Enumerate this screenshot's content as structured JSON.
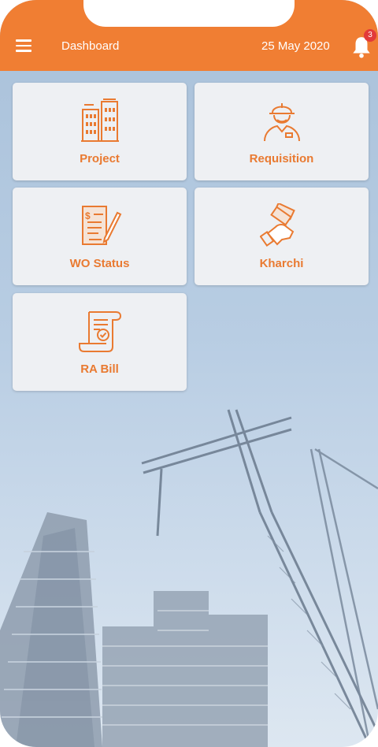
{
  "header": {
    "title": "Dashboard",
    "date": "25 May 2020",
    "notification_count": "3",
    "menu_icon": "hamburger-menu-icon",
    "bell_icon": "bell-icon",
    "color": "#f07e33"
  },
  "tiles": [
    {
      "label": "Project",
      "icon": "buildings-icon"
    },
    {
      "label": "Requisition",
      "icon": "worker-icon"
    },
    {
      "label": "WO Status",
      "icon": "document-pen-icon"
    },
    {
      "label": "Kharchi",
      "icon": "hand-money-icon"
    },
    {
      "label": "RA Bill",
      "icon": "scroll-check-icon"
    }
  ],
  "accent_color": "#e97a31"
}
